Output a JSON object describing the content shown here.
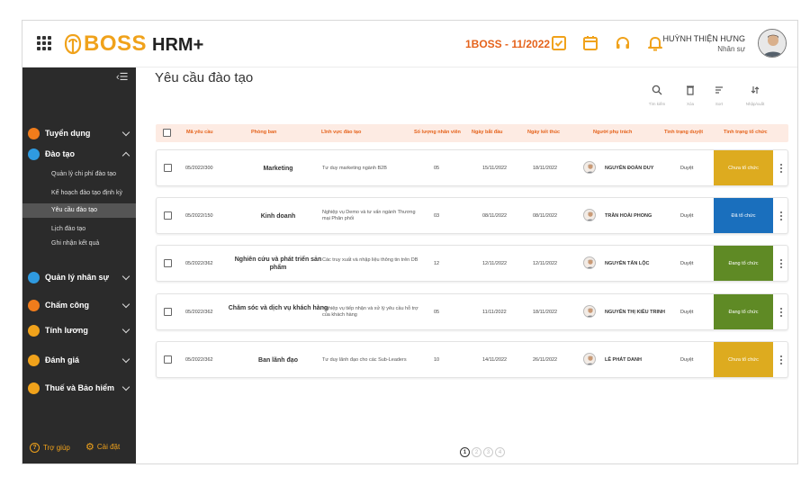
{
  "header": {
    "brand": "BOSS",
    "product": "HRM+",
    "period": "1BOSS - 11/2022",
    "user_name": "HUỲNH THIỆN HƯNG",
    "user_role": "Nhân sự",
    "icons": [
      "apps-grid-icon",
      "checkbox-icon",
      "calendar-icon",
      "headset-icon",
      "bell-icon"
    ]
  },
  "sidebar": {
    "menus": [
      {
        "label": "Tuyển dụng",
        "color": "#f07c1b",
        "expanded": false
      },
      {
        "label": "Đào tạo",
        "color": "#2f9ae0",
        "expanded": true
      },
      {
        "label": "Quản lý nhân sự",
        "color": "#2f9ae0",
        "expanded": false
      },
      {
        "label": "Chấm công",
        "color": "#f07c1b",
        "expanded": false
      },
      {
        "label": "Tính lương",
        "color": "#f0a21b",
        "expanded": false
      },
      {
        "label": "Đánh giá",
        "color": "#f0a21b",
        "expanded": false
      },
      {
        "label": "Thuế và Bảo hiểm",
        "color": "#f0a21b",
        "expanded": false
      }
    ],
    "submenus": [
      "Quản lý chi phí đào tạo",
      "Kế hoạch đào tạo định kỳ",
      "Yêu cầu đào tạo",
      "Lịch đào tạo",
      "Ghi nhận kết quả"
    ],
    "active_submenu": "Yêu cầu đào tạo",
    "help": "Trợ giúp",
    "settings": "Cài đặt"
  },
  "page": {
    "title": "Yêu cầu đào tạo",
    "tools": [
      "Tìm kiếm",
      "Xóa",
      "Sort",
      "Nhập/xuất"
    ]
  },
  "table": {
    "columns": [
      "Mã yêu cầu",
      "Phòng ban",
      "Lĩnh vực đào tạo",
      "Số lượng nhân viên",
      "Ngày bắt đầu",
      "Ngày kết thúc",
      "Người phụ trách",
      "Tình trạng duyệt",
      "Tình trạng tổ chức"
    ],
    "rows": [
      {
        "code": "05/2022/300",
        "dept": "Marketing",
        "field": "Tư duy marketing ngành B2B",
        "qty": "05",
        "start": "15/11/2022",
        "end": "18/11/2022",
        "person": "NGUYỄN ĐOÀN DUY",
        "approval": "Duyệt",
        "status": "Chưa tổ chức",
        "status_color": "#ddab1f"
      },
      {
        "code": "05/2022/150",
        "dept": "Kinh doanh",
        "field": "Nghiệp vụ Demo và tư vấn ngành Thương mại Phân phối",
        "qty": "03",
        "start": "08/11/2022",
        "end": "08/11/2022",
        "person": "TRẦN HOÀI PHONG",
        "approval": "Duyệt",
        "status": "Đã tổ chức",
        "status_color": "#1a6fbd"
      },
      {
        "code": "05/2022/362",
        "dept": "Nghiên cứu và phát triển sản phẩm",
        "field": "Các truy xuất và nhập liệu thông tin trên DB",
        "qty": "12",
        "start": "12/11/2022",
        "end": "12/11/2022",
        "person": "NGUYỄN TẤN LỘC",
        "approval": "Duyệt",
        "status": "Đang tổ chức",
        "status_color": "#5f8a25"
      },
      {
        "code": "05/2022/362",
        "dept": "Chăm sóc và dịch vụ khách hàng",
        "field": "Nghiệp vụ tiếp nhận và xử lý yêu cầu hỗ trợ của khách hàng",
        "qty": "05",
        "start": "11/11/2022",
        "end": "18/11/2022",
        "person": "NGUYỄN THỊ KIỀU TRINH",
        "approval": "Duyệt",
        "status": "Đang tổ chức",
        "status_color": "#5f8a25"
      },
      {
        "code": "05/2022/362",
        "dept": "Ban lãnh đạo",
        "field": "Tư duy lãnh đạo cho các Sub-Leaders",
        "qty": "10",
        "start": "14/11/2022",
        "end": "26/11/2022",
        "person": "LÊ PHÁT DANH",
        "approval": "Duyệt",
        "status": "Chưa tổ chức",
        "status_color": "#ddab1f"
      }
    ]
  },
  "pagination": {
    "pages": [
      "1",
      "2",
      "3",
      "4"
    ],
    "current": "1"
  }
}
